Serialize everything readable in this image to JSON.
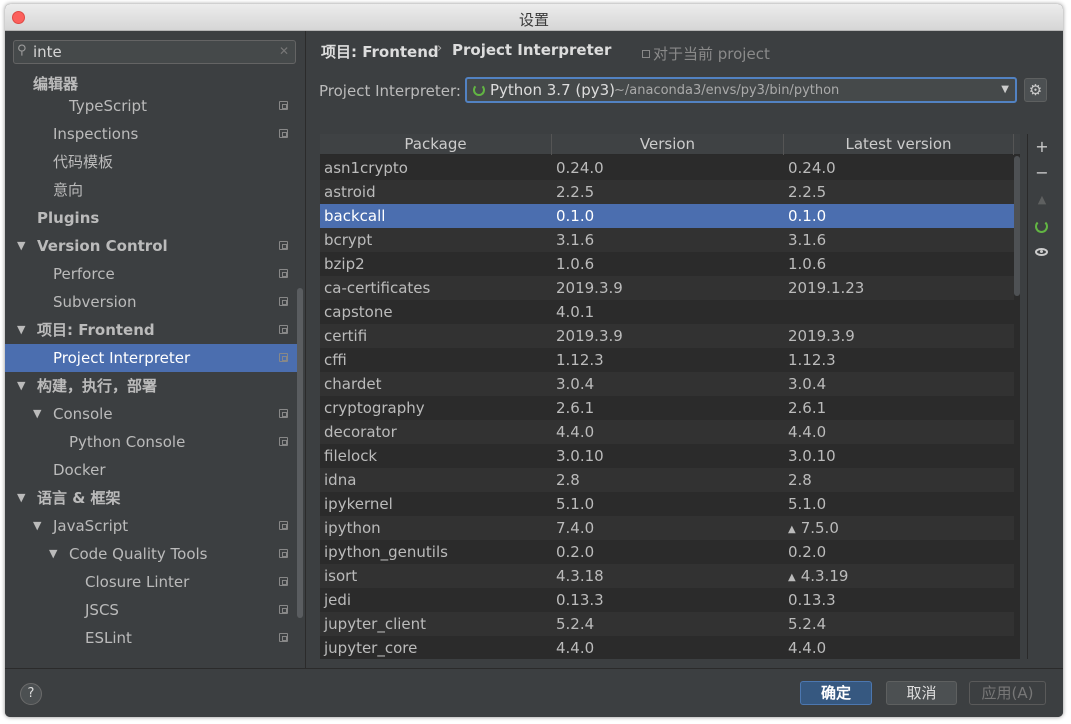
{
  "window": {
    "title": "设置"
  },
  "search": {
    "value": "inte"
  },
  "sidebar": {
    "items": [
      {
        "label": "JavaScript",
        "level": 2,
        "bold": false,
        "arrow": "",
        "copy": true,
        "clipped": true
      },
      {
        "label": "TypeScript",
        "level": 2,
        "bold": false,
        "arrow": "",
        "copy": true
      },
      {
        "label": "Inspections",
        "level": 1,
        "bold": false,
        "arrow": "",
        "copy": true
      },
      {
        "label": "代码模板",
        "level": 1,
        "bold": false,
        "arrow": "",
        "copy": false
      },
      {
        "label": "意向",
        "level": 1,
        "bold": false,
        "arrow": "",
        "copy": false
      },
      {
        "label": "Plugins",
        "level": 0,
        "bold": true,
        "arrow": "",
        "copy": false
      },
      {
        "label": "Version Control",
        "level": 0,
        "bold": true,
        "arrow": "▼",
        "copy": true
      },
      {
        "label": "Perforce",
        "level": 1,
        "bold": false,
        "arrow": "",
        "copy": true
      },
      {
        "label": "Subversion",
        "level": 1,
        "bold": false,
        "arrow": "",
        "copy": true
      },
      {
        "label": "项目: Frontend",
        "level": 0,
        "bold": true,
        "arrow": "▼",
        "copy": true
      },
      {
        "label": "Project Interpreter",
        "level": 1,
        "bold": false,
        "arrow": "",
        "copy": true,
        "selected": true
      },
      {
        "label": "构建，执行，部署",
        "level": 0,
        "bold": true,
        "arrow": "▼",
        "copy": false
      },
      {
        "label": "Console",
        "level": 1,
        "bold": false,
        "arrow": "▼",
        "copy": true
      },
      {
        "label": "Python Console",
        "level": 2,
        "bold": false,
        "arrow": "",
        "copy": true
      },
      {
        "label": "Docker",
        "level": 1,
        "bold": false,
        "arrow": "",
        "copy": false
      },
      {
        "label": "语言 & 框架",
        "level": 0,
        "bold": true,
        "arrow": "▼",
        "copy": false
      },
      {
        "label": "JavaScript",
        "level": 1,
        "bold": false,
        "arrow": "▼",
        "copy": true
      },
      {
        "label": "Code Quality Tools",
        "level": 2,
        "bold": false,
        "arrow": "▼",
        "copy": true
      },
      {
        "label": "Closure Linter",
        "level": 3,
        "bold": false,
        "arrow": "",
        "copy": true
      },
      {
        "label": "JSCS",
        "level": 3,
        "bold": false,
        "arrow": "",
        "copy": true
      },
      {
        "label": "ESLint",
        "level": 3,
        "bold": false,
        "arrow": "",
        "copy": true
      }
    ],
    "sticky_header": "编辑器"
  },
  "breadcrumb": {
    "first": "项目: Frontend",
    "separator": "›",
    "second": "Project Interpreter",
    "scope_note": "对于当前 project"
  },
  "interpreter": {
    "label": "Project Interpreter:",
    "name": "Python 3.7 (py3)",
    "path": "~/anaconda3/envs/py3/bin/python"
  },
  "table": {
    "columns": [
      "Package",
      "Version",
      "Latest version"
    ],
    "rows": [
      {
        "package": "asn1crypto",
        "version": "0.24.0",
        "latest": "0.24.0",
        "upgrade": false
      },
      {
        "package": "astroid",
        "version": "2.2.5",
        "latest": "2.2.5",
        "upgrade": false
      },
      {
        "package": "backcall",
        "version": "0.1.0",
        "latest": "0.1.0",
        "upgrade": false,
        "selected": true
      },
      {
        "package": "bcrypt",
        "version": "3.1.6",
        "latest": "3.1.6",
        "upgrade": false
      },
      {
        "package": "bzip2",
        "version": "1.0.6",
        "latest": "1.0.6",
        "upgrade": false
      },
      {
        "package": "ca-certificates",
        "version": "2019.3.9",
        "latest": "2019.1.23",
        "upgrade": false
      },
      {
        "package": "capstone",
        "version": "4.0.1",
        "latest": "",
        "upgrade": false
      },
      {
        "package": "certifi",
        "version": "2019.3.9",
        "latest": "2019.3.9",
        "upgrade": false
      },
      {
        "package": "cffi",
        "version": "1.12.3",
        "latest": "1.12.3",
        "upgrade": false
      },
      {
        "package": "chardet",
        "version": "3.0.4",
        "latest": "3.0.4",
        "upgrade": false
      },
      {
        "package": "cryptography",
        "version": "2.6.1",
        "latest": "2.6.1",
        "upgrade": false
      },
      {
        "package": "decorator",
        "version": "4.4.0",
        "latest": "4.4.0",
        "upgrade": false
      },
      {
        "package": "filelock",
        "version": "3.0.10",
        "latest": "3.0.10",
        "upgrade": false
      },
      {
        "package": "idna",
        "version": "2.8",
        "latest": "2.8",
        "upgrade": false
      },
      {
        "package": "ipykernel",
        "version": "5.1.0",
        "latest": "5.1.0",
        "upgrade": false
      },
      {
        "package": "ipython",
        "version": "7.4.0",
        "latest": "7.5.0",
        "upgrade": true
      },
      {
        "package": "ipython_genutils",
        "version": "0.2.0",
        "latest": "0.2.0",
        "upgrade": false
      },
      {
        "package": "isort",
        "version": "4.3.18",
        "latest": "4.3.19",
        "upgrade": true
      },
      {
        "package": "jedi",
        "version": "0.13.3",
        "latest": "0.13.3",
        "upgrade": false
      },
      {
        "package": "jupyter_client",
        "version": "5.2.4",
        "latest": "5.2.4",
        "upgrade": false
      },
      {
        "package": "jupyter_core",
        "version": "4.4.0",
        "latest": "4.4.0",
        "upgrade": false
      }
    ]
  },
  "tools": {
    "add": "+",
    "remove": "−",
    "up": "▲"
  },
  "footer": {
    "help": "?",
    "ok": "确定",
    "cancel": "取消",
    "apply": "应用(A)"
  },
  "colors": {
    "background": "#3c3f41",
    "selection": "#4b6eaf",
    "table_bg": "#2b2b2b",
    "accent_green": "#62b543"
  }
}
